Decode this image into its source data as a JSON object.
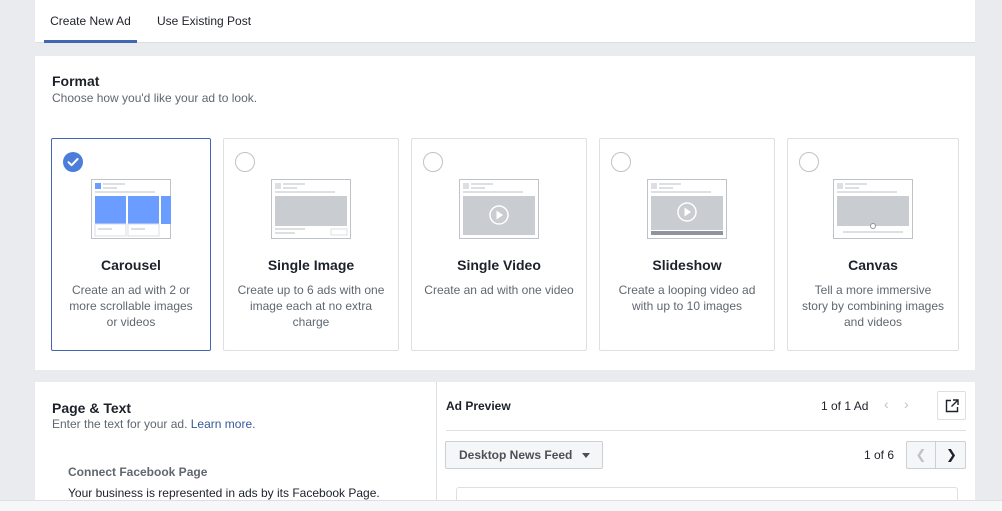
{
  "tabs": [
    {
      "label": "Create New Ad",
      "active": true
    },
    {
      "label": "Use Existing Post",
      "active": false
    }
  ],
  "format": {
    "title": "Format",
    "subtitle": "Choose how you'd like your ad to look.",
    "options": [
      {
        "name": "Carousel",
        "desc": "Create an ad with 2 or more scrollable images or videos",
        "selected": true
      },
      {
        "name": "Single Image",
        "desc": "Create up to 6 ads with one image each at no extra charge",
        "selected": false
      },
      {
        "name": "Single Video",
        "desc": "Create an ad with one video",
        "selected": false
      },
      {
        "name": "Slideshow",
        "desc": "Create a looping video ad with up to 10 images",
        "selected": false
      },
      {
        "name": "Canvas",
        "desc": "Tell a more immersive story by combining images and videos",
        "selected": false
      }
    ]
  },
  "page_text": {
    "title": "Page & Text",
    "subtitle": "Enter the text for your ad.",
    "learn_more": "Learn more.",
    "connect_title": "Connect Facebook Page",
    "connect_desc": "Your business is represented in ads by its Facebook Page."
  },
  "preview": {
    "title": "Ad Preview",
    "ad_count": "1 of 1 Ad",
    "placement": "Desktop News Feed",
    "page_count": "1 of 6"
  },
  "colors": {
    "accent": "#4267b2",
    "selected_check": "#4c7ddb",
    "thumb_blue": "#6b9cff"
  }
}
